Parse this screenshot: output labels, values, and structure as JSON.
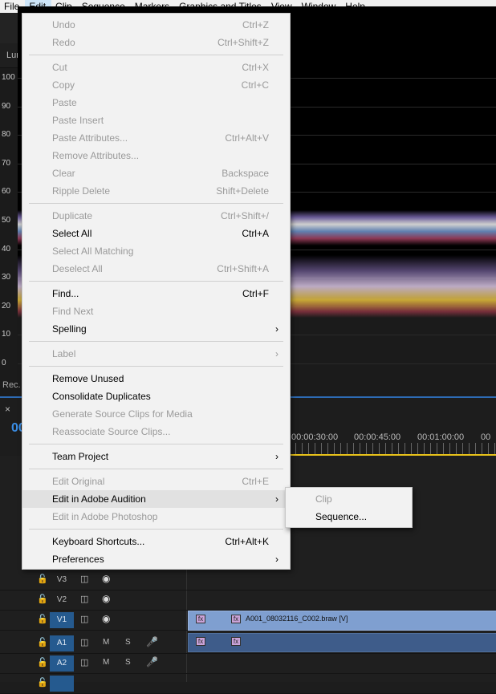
{
  "menubar": {
    "items": [
      "File",
      "Edit",
      "Clip",
      "Sequence",
      "Markers",
      "Graphics and Titles",
      "View",
      "Window",
      "Help"
    ],
    "active": "Edit"
  },
  "panel": {
    "tab_label": "Lum",
    "rec_label": "Rec."
  },
  "scope": {
    "y_labels": [
      "100",
      "90",
      "80",
      "70",
      "60",
      "50",
      "40",
      "30",
      "20",
      "10",
      "0"
    ]
  },
  "timeline": {
    "close": "×",
    "timecode": "00",
    "ruler_times": [
      "00:00:30:00",
      "00:00:45:00",
      "00:01:00:00",
      "00"
    ],
    "tracks": [
      {
        "name": "V3",
        "kind": "video"
      },
      {
        "name": "V2",
        "kind": "video"
      },
      {
        "name": "V1",
        "kind": "video",
        "selected": true
      },
      {
        "name": "A1",
        "kind": "audio",
        "selected": true
      },
      {
        "name": "A2",
        "kind": "audio",
        "selected": true
      }
    ],
    "clip_label": "A001_08032116_C002.braw [V]",
    "fx": "fx"
  },
  "edit_menu": {
    "items": [
      {
        "label": "Undo",
        "shortcut": "Ctrl+Z",
        "enabled": false
      },
      {
        "label": "Redo",
        "shortcut": "Ctrl+Shift+Z",
        "enabled": false
      },
      {
        "sep": true
      },
      {
        "label": "Cut",
        "shortcut": "Ctrl+X",
        "enabled": false
      },
      {
        "label": "Copy",
        "shortcut": "Ctrl+C",
        "enabled": false
      },
      {
        "label": "Paste",
        "shortcut": "",
        "enabled": false
      },
      {
        "label": "Paste Insert",
        "shortcut": "",
        "enabled": false
      },
      {
        "label": "Paste Attributes...",
        "shortcut": "Ctrl+Alt+V",
        "enabled": false
      },
      {
        "label": "Remove Attributes...",
        "shortcut": "",
        "enabled": false
      },
      {
        "label": "Clear",
        "shortcut": "Backspace",
        "enabled": false
      },
      {
        "label": "Ripple Delete",
        "shortcut": "Shift+Delete",
        "enabled": false
      },
      {
        "sep": true
      },
      {
        "label": "Duplicate",
        "shortcut": "Ctrl+Shift+/",
        "enabled": false
      },
      {
        "label": "Select All",
        "shortcut": "Ctrl+A",
        "enabled": true
      },
      {
        "label": "Select All Matching",
        "shortcut": "",
        "enabled": false
      },
      {
        "label": "Deselect All",
        "shortcut": "Ctrl+Shift+A",
        "enabled": false
      },
      {
        "sep": true
      },
      {
        "label": "Find...",
        "shortcut": "Ctrl+F",
        "enabled": true
      },
      {
        "label": "Find Next",
        "shortcut": "",
        "enabled": false
      },
      {
        "label": "Spelling",
        "shortcut": "",
        "enabled": true,
        "submenu": true
      },
      {
        "sep": true
      },
      {
        "label": "Label",
        "shortcut": "",
        "enabled": false,
        "submenu": true
      },
      {
        "sep": true
      },
      {
        "label": "Remove Unused",
        "shortcut": "",
        "enabled": true
      },
      {
        "label": "Consolidate Duplicates",
        "shortcut": "",
        "enabled": true
      },
      {
        "label": "Generate Source Clips for Media",
        "shortcut": "",
        "enabled": false
      },
      {
        "label": "Reassociate Source Clips...",
        "shortcut": "",
        "enabled": false
      },
      {
        "sep": true
      },
      {
        "label": "Team Project",
        "shortcut": "",
        "enabled": true,
        "submenu": true
      },
      {
        "sep": true
      },
      {
        "label": "Edit Original",
        "shortcut": "Ctrl+E",
        "enabled": false
      },
      {
        "label": "Edit in Adobe Audition",
        "shortcut": "",
        "enabled": true,
        "submenu": true,
        "highlight": true
      },
      {
        "label": "Edit in Adobe Photoshop",
        "shortcut": "",
        "enabled": false
      },
      {
        "sep": true
      },
      {
        "label": "Keyboard Shortcuts...",
        "shortcut": "Ctrl+Alt+K",
        "enabled": true
      },
      {
        "label": "Preferences",
        "shortcut": "",
        "enabled": true,
        "submenu": true
      }
    ]
  },
  "audition_submenu": {
    "items": [
      {
        "label": "Clip",
        "enabled": false
      },
      {
        "label": "Sequence...",
        "enabled": true
      }
    ]
  },
  "icons": {
    "submenu_arrow": "chevron-right-icon",
    "lock": "lock-icon",
    "film": "film-icon",
    "eye": "eye-icon",
    "mic": "mic-icon"
  }
}
